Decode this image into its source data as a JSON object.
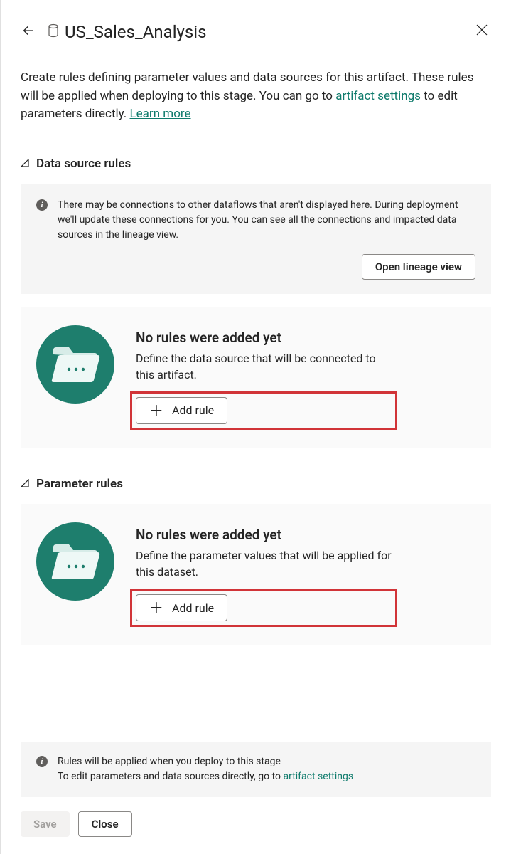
{
  "header": {
    "title": "US_Sales_Analysis"
  },
  "description": {
    "text_prefix": "Create rules defining parameter values and data sources for this artifact. These rules will be applied when deploying to this stage. You can go to ",
    "artifact_settings_link": "artifact settings",
    "text_middle": " to edit parameters directly. ",
    "learn_more": "Learn more"
  },
  "sections": {
    "data_source": {
      "title": "Data source rules",
      "info": "There may be connections to other dataflows that aren't displayed here. During deployment we'll update these connections for you. You can see all the connections and impacted data sources in the lineage view.",
      "open_lineage_btn": "Open lineage view",
      "empty_title": "No rules were added yet",
      "empty_desc": "Define the data source that will be connected to this artifact.",
      "add_rule_btn": "Add rule"
    },
    "parameter": {
      "title": "Parameter rules",
      "empty_title": "No rules were added yet",
      "empty_desc": "Define the parameter values that will be applied for this dataset.",
      "add_rule_btn": "Add rule"
    }
  },
  "footer_info": {
    "line1": "Rules will be applied when you deploy to this stage",
    "line2_prefix": "To edit parameters and data sources directly, go to ",
    "artifact_settings_link": "artifact settings"
  },
  "footer": {
    "save": "Save",
    "close": "Close"
  }
}
